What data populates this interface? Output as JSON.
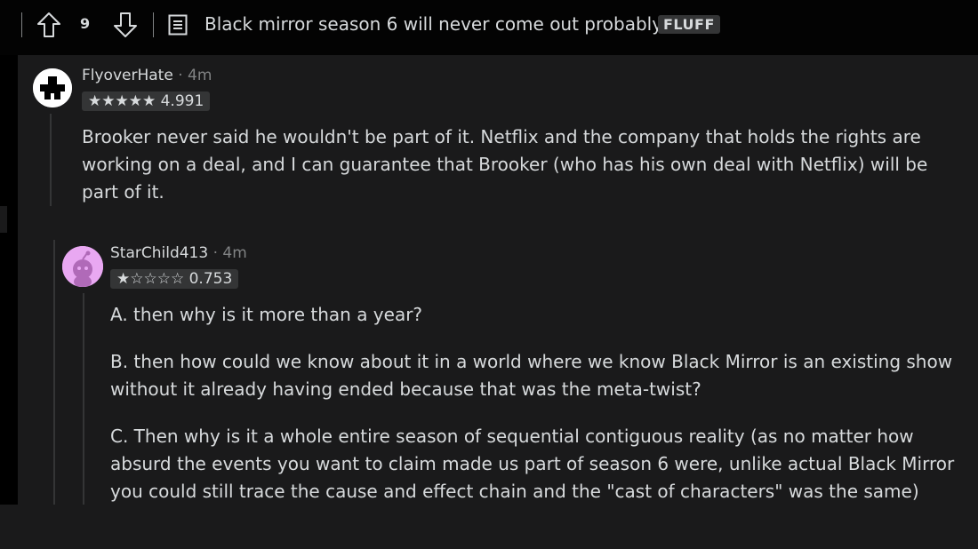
{
  "post": {
    "vote_count": "9",
    "title": "Black mirror season 6 will never come out probably..",
    "flair": "FLUFF"
  },
  "comments": [
    {
      "username": "FlyoverHate",
      "separator": "·",
      "time": "4m",
      "rating": "★★★★★ 4.991",
      "paragraphs": [
        "Brooker never said he wouldn't be part of it. Netflix and the company that holds the rights are working on a deal, and I can guarantee that Brooker (who has his own deal with Netflix) will be part of it."
      ]
    },
    {
      "username": "StarChild413",
      "separator": "·",
      "time": "4m",
      "rating": "★☆☆☆☆ 0.753",
      "paragraphs": [
        "A. then why is it more than a year?",
        "B. then how could we know about it in a world where we know Black Mirror is an existing show without it already having ended because that was the meta-twist?",
        "C. Then why is it a whole entire season of sequential contiguous reality (as no matter how absurd the events you want to claim made us part of season 6 were, unlike actual Black Mirror you could still trace the cause and effect chain and the \"cast of characters\" was the same)"
      ]
    }
  ]
}
